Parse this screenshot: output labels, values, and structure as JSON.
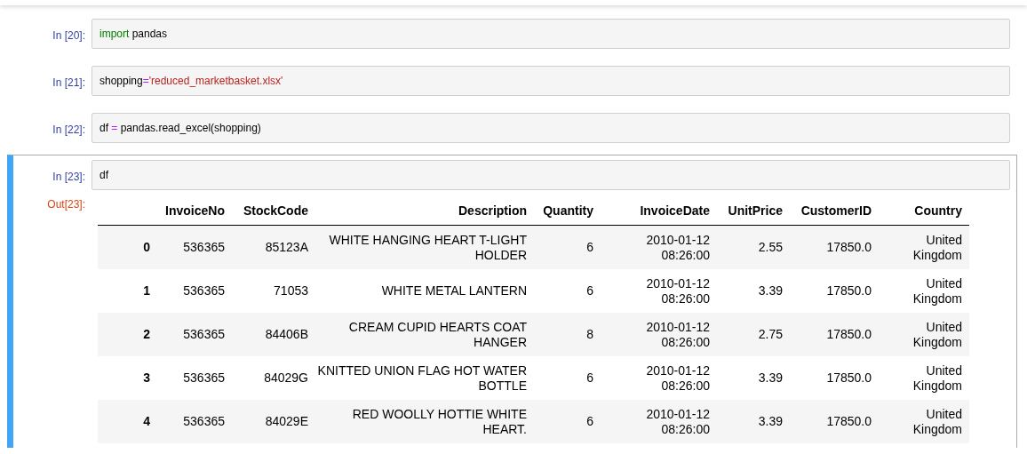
{
  "cells": [
    {
      "prompt": "In [20]:",
      "selected": false,
      "code": [
        {
          "kind": "keyword",
          "text": "import"
        },
        {
          "kind": "plain",
          "text": " pandas"
        }
      ]
    },
    {
      "prompt": "In [21]:",
      "selected": false,
      "code": [
        {
          "kind": "plain",
          "text": "shopping"
        },
        {
          "kind": "operator",
          "text": "="
        },
        {
          "kind": "string",
          "text": "'reduced_marketbasket.xlsx'"
        }
      ]
    },
    {
      "prompt": "In [22]:",
      "selected": false,
      "code": [
        {
          "kind": "plain",
          "text": "df "
        },
        {
          "kind": "operator",
          "text": "="
        },
        {
          "kind": "plain",
          "text": " pandas.read_excel(shopping)"
        }
      ]
    },
    {
      "prompt": "In [23]:",
      "selected": true,
      "code": [
        {
          "kind": "plain",
          "text": "df"
        }
      ],
      "output": {
        "prompt": "Out[23]:",
        "table": {
          "columns": [
            "InvoiceNo",
            "StockCode",
            "Description",
            "Quantity",
            "InvoiceDate",
            "UnitPrice",
            "CustomerID",
            "Country"
          ],
          "rows": [
            {
              "index": "0",
              "cells": [
                "536365",
                "85123A",
                "WHITE HANGING HEART T-LIGHT HOLDER",
                "6",
                "2010-01-12 08:26:00",
                "2.55",
                "17850.0",
                "United Kingdom"
              ]
            },
            {
              "index": "1",
              "cells": [
                "536365",
                "71053",
                "WHITE METAL LANTERN",
                "6",
                "2010-01-12 08:26:00",
                "3.39",
                "17850.0",
                "United Kingdom"
              ]
            },
            {
              "index": "2",
              "cells": [
                "536365",
                "84406B",
                "CREAM CUPID HEARTS COAT HANGER",
                "8",
                "2010-01-12 08:26:00",
                "2.75",
                "17850.0",
                "United Kingdom"
              ]
            },
            {
              "index": "3",
              "cells": [
                "536365",
                "84029G",
                "KNITTED UNION FLAG HOT WATER BOTTLE",
                "6",
                "2010-01-12 08:26:00",
                "3.39",
                "17850.0",
                "United Kingdom"
              ]
            },
            {
              "index": "4",
              "cells": [
                "536365",
                "84029E",
                "RED WOOLLY HOTTIE WHITE HEART.",
                "6",
                "2010-01-12 08:26:00",
                "3.39",
                "17850.0",
                "United Kingdom"
              ]
            }
          ]
        }
      }
    }
  ]
}
